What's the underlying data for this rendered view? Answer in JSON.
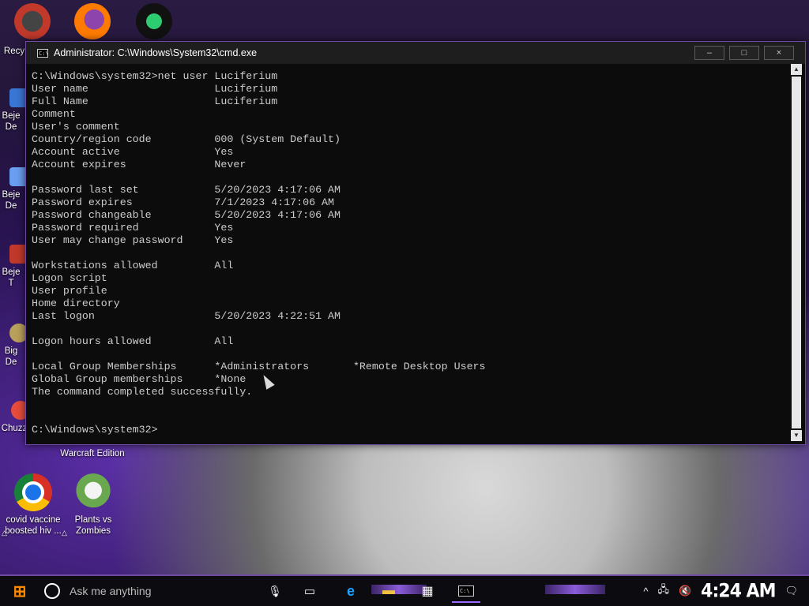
{
  "desktop": {
    "icons": [
      {
        "id": "chrome",
        "label": "covid vaccine boosted hiv ..."
      },
      {
        "id": "plants",
        "label": "Plants vs Zombies"
      }
    ],
    "partial_labels": {
      "recycle": "Recy",
      "beje1": "Beje",
      "de1": "De",
      "beje2": "Beje",
      "de2": "De",
      "beje3": "Beje",
      "t3": "T",
      "big": "Big",
      "de4": "De",
      "chuzz": "Chuzz",
      "warcraft": "Warcraft Edition"
    }
  },
  "cmd_window": {
    "title": "Administrator: C:\\Windows\\System32\\cmd.exe",
    "buttons": {
      "minimize": "–",
      "maximize": "□",
      "close": "×"
    },
    "lines": [
      "C:\\Windows\\system32>net user Luciferium",
      "User name                    Luciferium",
      "Full Name                    Luciferium",
      "Comment",
      "User's comment",
      "Country/region code          000 (System Default)",
      "Account active               Yes",
      "Account expires              Never",
      "",
      "Password last set            5/20/2023 4:17:06 AM",
      "Password expires             7/1/2023 4:17:06 AM",
      "Password changeable          5/20/2023 4:17:06 AM",
      "Password required            Yes",
      "User may change password     Yes",
      "",
      "Workstations allowed         All",
      "Logon script",
      "User profile",
      "Home directory",
      "Last logon                   5/20/2023 4:22:51 AM",
      "",
      "Logon hours allowed          All",
      "",
      "Local Group Memberships      *Administrators       *Remote Desktop Users",
      "Global Group memberships     *None",
      "The command completed successfully.",
      "",
      "",
      "C:\\Windows\\system32>"
    ]
  },
  "taskbar": {
    "search_placeholder": "Ask me anything",
    "clock": "4:24 AM"
  }
}
